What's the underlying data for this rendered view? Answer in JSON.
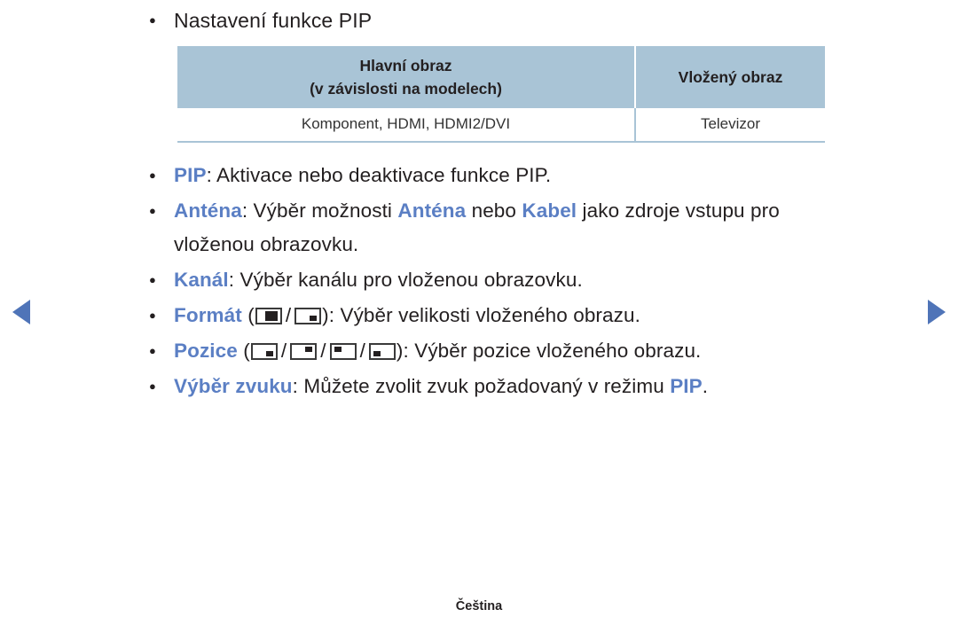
{
  "nav": {
    "prev_icon": "triangle-left-icon",
    "next_icon": "triangle-right-icon",
    "accent_color": "#4f74b8"
  },
  "heading": {
    "text": "Nastavení funkce PIP"
  },
  "table": {
    "header_bg": "#a9c4d6",
    "columns": [
      {
        "line1": "Hlavní obraz",
        "line2": "(v závislosti na modelech)"
      },
      {
        "line1": "Vložený obraz",
        "line2": ""
      }
    ],
    "rows": [
      [
        "Komponent, HDMI, HDMI2/DVI",
        "Televizor"
      ]
    ]
  },
  "items": [
    {
      "term": "PIP",
      "rest": ": Aktivace nebo deaktivace funkce PIP.",
      "icons": []
    },
    {
      "term": "Anténa",
      "pre": ": Výběr možnosti ",
      "inline1": "Anténa",
      "mid": " nebo ",
      "inline2": "Kabel",
      "post": " jako zdroje vstupu pro vloženou obrazovku.",
      "icons": []
    },
    {
      "term": "Kanál",
      "rest": ": Výběr kanálu pro vloženou obrazovku.",
      "icons": []
    },
    {
      "term": "Formát",
      "open": " (",
      "close": "): Výběr velikosti vloženého obrazu.",
      "separator": "/",
      "icons": [
        "pip-size-large-icon",
        "pip-size-small-icon"
      ]
    },
    {
      "term": "Pozice",
      "open": " (",
      "close": "): Výběr pozice vloženého obrazu.",
      "separator": "/",
      "icons": [
        "pip-position-bottom-right-icon",
        "pip-position-top-right-icon",
        "pip-position-top-left-icon",
        "pip-position-bottom-left-icon"
      ]
    },
    {
      "term": "Výběr zvuku",
      "pre": ": Můžete zvolit zvuk požadovaný v režimu ",
      "inline1": "PIP",
      "post": ".",
      "icons": []
    }
  ],
  "footer": {
    "language": "Čeština"
  },
  "colors": {
    "keyword": "#5b7fc4",
    "text": "#231f20",
    "table_header": "#a9c4d6"
  }
}
